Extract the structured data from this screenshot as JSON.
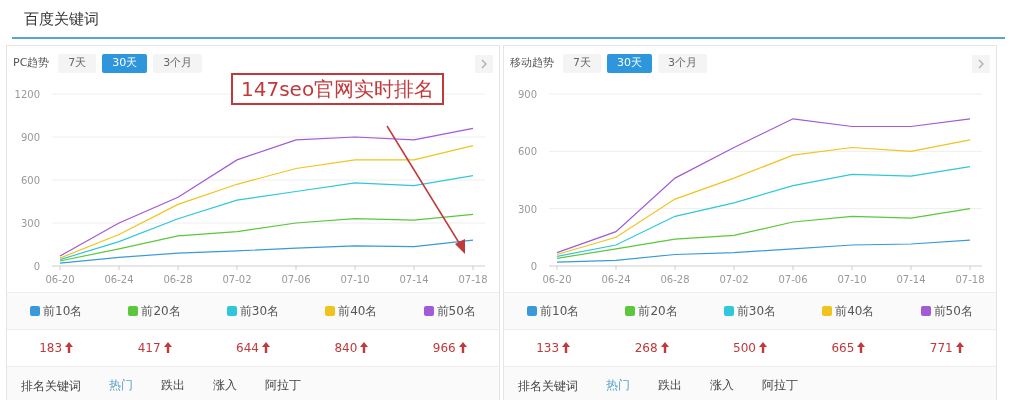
{
  "title": "百度关键词",
  "panels": [
    {
      "label": "PC趋势",
      "ranges": [
        {
          "label": "7天",
          "selected": false
        },
        {
          "label": "30天",
          "selected": true
        },
        {
          "label": "3个月",
          "selected": false
        }
      ],
      "annotation": {
        "text": "147seo官网实时排名"
      },
      "chart_data": {
        "type": "line",
        "categories": [
          "06-20",
          "06-24",
          "06-28",
          "07-02",
          "07-06",
          "07-10",
          "07-14",
          "07-18"
        ],
        "grid": true,
        "ylim": [
          0,
          1200
        ],
        "yticks": [
          0,
          300,
          600,
          900,
          1200
        ],
        "series": [
          {
            "name": "前10名",
            "color": "#3a9ad9",
            "values": [
              20,
              60,
              90,
              105,
              125,
              140,
              135,
              180
            ]
          },
          {
            "name": "前20名",
            "color": "#5cc73c",
            "values": [
              35,
              120,
              210,
              240,
              300,
              330,
              320,
              360
            ]
          },
          {
            "name": "前30名",
            "color": "#2ec8d8",
            "values": [
              45,
              170,
              330,
              460,
              520,
              580,
              560,
              630
            ]
          },
          {
            "name": "前40名",
            "color": "#f2c31c",
            "values": [
              55,
              220,
              430,
              570,
              680,
              740,
              740,
              840
            ]
          },
          {
            "name": "前50名",
            "color": "#a25ad6",
            "values": [
              70,
              300,
              480,
              740,
              880,
              900,
              880,
              960
            ]
          }
        ]
      },
      "stats": [
        {
          "value": "183",
          "rising": true
        },
        {
          "value": "417",
          "rising": true
        },
        {
          "value": "644",
          "rising": true
        },
        {
          "value": "840",
          "rising": true
        },
        {
          "value": "966",
          "rising": true
        }
      ],
      "tabs_label": "排名关键词",
      "tabs": [
        {
          "label": "热门",
          "selected": true
        },
        {
          "label": "跌出",
          "selected": false
        },
        {
          "label": "涨入",
          "selected": false
        },
        {
          "label": "阿拉丁",
          "selected": false
        }
      ]
    },
    {
      "label": "移动趋势",
      "ranges": [
        {
          "label": "7天",
          "selected": false
        },
        {
          "label": "30天",
          "selected": true
        },
        {
          "label": "3个月",
          "selected": false
        }
      ],
      "chart_data": {
        "type": "line",
        "categories": [
          "06-20",
          "06-24",
          "06-28",
          "07-02",
          "07-06",
          "07-10",
          "07-14",
          "07-18"
        ],
        "grid": true,
        "ylim": [
          0,
          900
        ],
        "yticks": [
          0,
          300,
          600,
          900
        ],
        "series": [
          {
            "name": "前10名",
            "color": "#3a9ad9",
            "values": [
              20,
              30,
              60,
              70,
              90,
              110,
              115,
              135
            ]
          },
          {
            "name": "前20名",
            "color": "#5cc73c",
            "values": [
              40,
              90,
              140,
              160,
              230,
              260,
              250,
              300
            ]
          },
          {
            "name": "前30名",
            "color": "#2ec8d8",
            "values": [
              50,
              110,
              260,
              330,
              420,
              480,
              470,
              520
            ]
          },
          {
            "name": "前40名",
            "color": "#f2c31c",
            "values": [
              60,
              150,
              350,
              460,
              580,
              620,
              600,
              660
            ]
          },
          {
            "name": "前50名",
            "color": "#a25ad6",
            "values": [
              70,
              180,
              460,
              620,
              770,
              730,
              730,
              770
            ]
          }
        ]
      },
      "stats": [
        {
          "value": "133",
          "rising": true
        },
        {
          "value": "268",
          "rising": true
        },
        {
          "value": "500",
          "rising": true
        },
        {
          "value": "665",
          "rising": true
        },
        {
          "value": "771",
          "rising": true
        }
      ],
      "tabs_label": "排名关键词",
      "tabs": [
        {
          "label": "热门",
          "selected": true
        },
        {
          "label": "跌出",
          "selected": false
        },
        {
          "label": "涨入",
          "selected": false
        },
        {
          "label": "阿拉丁",
          "selected": false
        }
      ]
    }
  ]
}
